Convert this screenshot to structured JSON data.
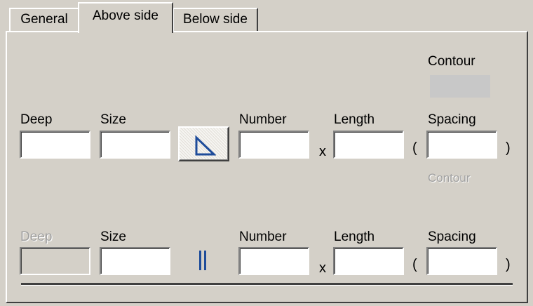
{
  "tabs": [
    {
      "label": "General",
      "active": false
    },
    {
      "label": "Above side",
      "active": true
    },
    {
      "label": "Below side",
      "active": false
    }
  ],
  "top_contour": {
    "label": "Contour",
    "swatch_color": "#c8c8c8"
  },
  "row1": {
    "deep_label": "Deep",
    "deep_value": "",
    "size_label": "Size",
    "size_value": "",
    "shape_icon": "right-triangle-icon",
    "number_label": "Number",
    "number_value": "",
    "times": "x",
    "length_label": "Length",
    "length_value": "",
    "open_paren": "(",
    "spacing_label": "Spacing",
    "spacing_value": "",
    "close_paren": ")",
    "contour_label": "Contour"
  },
  "row2": {
    "deep_label": "Deep",
    "deep_value": "",
    "deep_disabled": true,
    "size_label": "Size",
    "size_value": "",
    "shape_icon": "double-bar-icon",
    "number_label": "Number",
    "number_value": "",
    "times": "x",
    "length_label": "Length",
    "length_value": "",
    "open_paren": "(",
    "spacing_label": "Spacing",
    "spacing_value": "",
    "close_paren": ")"
  },
  "colors": {
    "face": "#d4d0c8",
    "icon_blue": "#1e4c9a",
    "disabled_text": "#a0a0a0"
  }
}
